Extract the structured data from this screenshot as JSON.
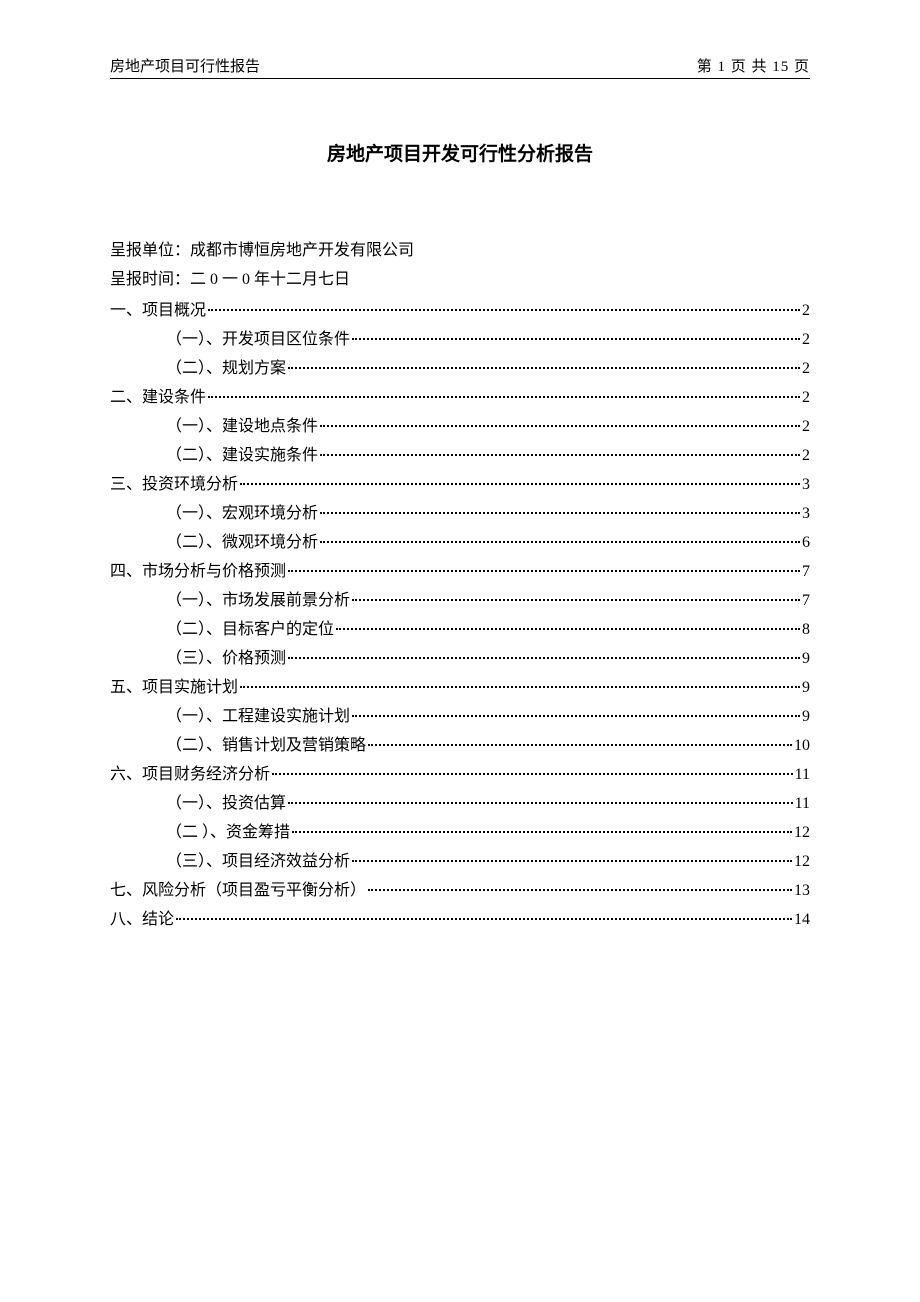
{
  "header": {
    "left": "房地产项目可行性报告",
    "right": "第 1 页 共 15 页"
  },
  "title": "房地产项目开发可行性分析报告",
  "meta": {
    "unit_label": "呈报单位：",
    "unit_value": "成都市博恒房地产开发有限公司",
    "date_label": "呈报时间：",
    "date_value": "二 0 一 0 年十二月七日"
  },
  "toc": [
    {
      "label": "一、项目概况",
      "page": "2",
      "level": 1
    },
    {
      "label": "（一）、开发项目区位条件",
      "page": "2",
      "level": 2
    },
    {
      "label": "（二）、规划方案",
      "page": "2",
      "level": 2
    },
    {
      "label": "二、建设条件",
      "page": "2",
      "level": 1
    },
    {
      "label": "（一）、建设地点条件",
      "page": "2",
      "level": 2
    },
    {
      "label": "（二）、建设实施条件",
      "page": "2",
      "level": 2
    },
    {
      "label": "三、投资环境分析",
      "page": "3",
      "level": 1
    },
    {
      "label": "（一）、宏观环境分析",
      "page": "3",
      "level": 2
    },
    {
      "label": "（二）、微观环境分析",
      "page": "6",
      "level": 2
    },
    {
      "label": "四、市场分析与价格预测",
      "page": "7",
      "level": 1
    },
    {
      "label": "（一）、市场发展前景分析",
      "page": "7",
      "level": 2
    },
    {
      "label": "（二）、目标客户的定位",
      "page": "8",
      "level": 2
    },
    {
      "label": "（三）、价格预测",
      "page": "9",
      "level": 2
    },
    {
      "label": "五、项目实施计划",
      "page": "9",
      "level": 1
    },
    {
      "label": "（一）、工程建设实施计划",
      "page": "9",
      "level": 2
    },
    {
      "label": "（二）、销售计划及营销策略",
      "page": "10",
      "level": 2
    },
    {
      "label": "六、项目财务经济分析",
      "page": "11",
      "level": 1
    },
    {
      "label": "（一）、投资估算",
      "page": "11",
      "level": 2
    },
    {
      "label": "（二 ）、资金筹措",
      "page": "12",
      "level": 2
    },
    {
      "label": "（三）、项目经济效益分析",
      "page": "12",
      "level": 2
    },
    {
      "label": "七、风险分析（项目盈亏平衡分析）",
      "page": "13",
      "level": 1
    },
    {
      "label": "八、结论",
      "page": "14",
      "level": 1
    }
  ]
}
